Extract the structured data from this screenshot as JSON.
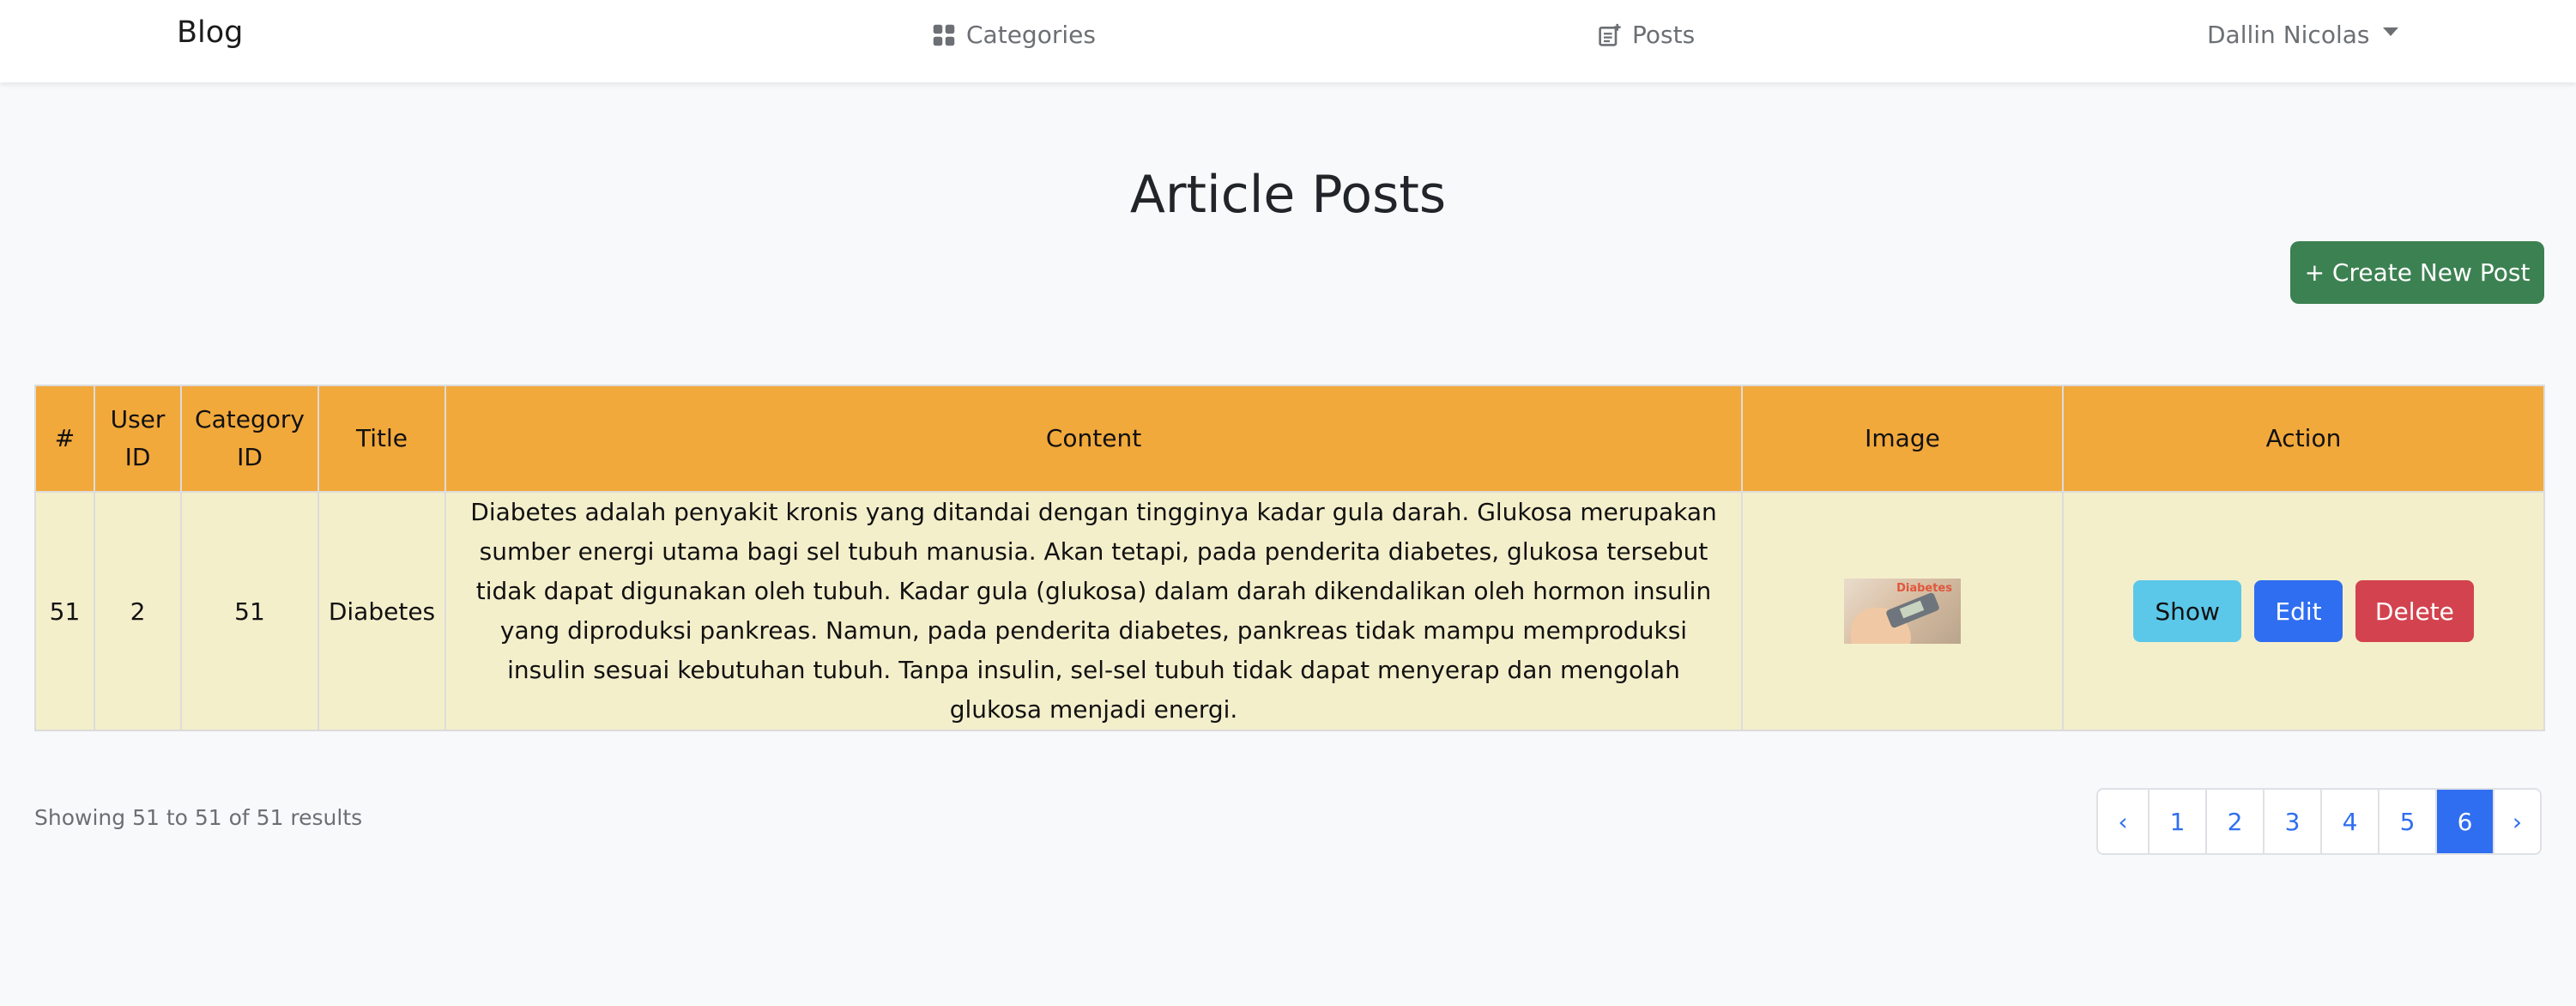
{
  "navbar": {
    "brand": "Blog",
    "categories_label": "Categories",
    "posts_label": "Posts",
    "user_name": "Dallin Nicolas"
  },
  "page": {
    "title": "Article Posts",
    "create_button_label": "+ Create New Post"
  },
  "table": {
    "headers": {
      "number": "#",
      "user_id": "User ID",
      "category_id": "Category ID",
      "title": "Title",
      "content": "Content",
      "image": "Image",
      "action": "Action"
    },
    "rows": [
      {
        "number": "51",
        "user_id": "2",
        "category_id": "51",
        "title": "Diabetes",
        "content": "Diabetes adalah penyakit kronis yang ditandai dengan tingginya kadar gula darah. Glukosa merupakan sumber energi utama bagi sel tubuh manusia. Akan tetapi, pada penderita diabetes, glukosa tersebut tidak dapat digunakan oleh tubuh. Kadar gula (glukosa) dalam darah dikendalikan oleh hormon insulin yang diproduksi pankreas. Namun, pada penderita diabetes, pankreas tidak mampu memproduksi insulin sesuai kebutuhan tubuh. Tanpa insulin, sel-sel tubuh tidak dapat menyerap dan mengolah glukosa menjadi energi.",
        "image_caption": "Diabetes",
        "actions": {
          "show": "Show",
          "edit": "Edit",
          "delete": "Delete"
        }
      }
    ]
  },
  "footer": {
    "results_text": "Showing 51 to 51 of 51 results",
    "pagination": {
      "prev": "‹",
      "pages": [
        "1",
        "2",
        "3",
        "4",
        "5",
        "6"
      ],
      "active_page": "6",
      "next": "›"
    }
  },
  "colors": {
    "header_bg": "#f2a93b",
    "row_bg": "#f4efcb",
    "create_button": "#3c8152",
    "show_button": "#5bc8ea",
    "edit_button": "#2f6ef0",
    "delete_button": "#d2434f",
    "active_page": "#2f6ef0"
  }
}
